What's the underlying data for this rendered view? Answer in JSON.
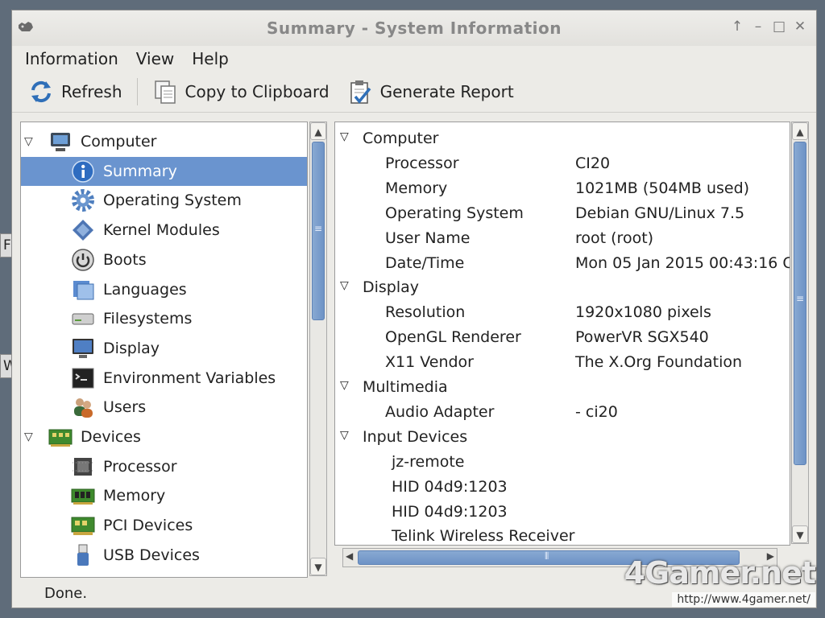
{
  "desktop": {
    "frag1": "Fi",
    "frag2": "Wa"
  },
  "window": {
    "title": "Summary - System Information",
    "controls": {
      "up": "↑",
      "minimize": "–",
      "maximize": "□",
      "close": "✕"
    }
  },
  "menu": [
    "Information",
    "View",
    "Help"
  ],
  "toolbar": {
    "refresh": "Refresh",
    "copy": "Copy to Clipboard",
    "report": "Generate Report"
  },
  "tree": [
    {
      "label": "Computer",
      "icon": "computer-icon",
      "level": 0,
      "expanded": true
    },
    {
      "label": "Summary",
      "icon": "info-icon",
      "level": 1,
      "selected": true
    },
    {
      "label": "Operating System",
      "icon": "gear-icon",
      "level": 1
    },
    {
      "label": "Kernel Modules",
      "icon": "module-icon",
      "level": 1
    },
    {
      "label": "Boots",
      "icon": "power-icon",
      "level": 1
    },
    {
      "label": "Languages",
      "icon": "language-icon",
      "level": 1
    },
    {
      "label": "Filesystems",
      "icon": "drive-icon",
      "level": 1
    },
    {
      "label": "Display",
      "icon": "monitor-icon",
      "level": 1
    },
    {
      "label": "Environment Variables",
      "icon": "terminal-icon",
      "level": 1
    },
    {
      "label": "Users",
      "icon": "users-icon",
      "level": 1
    },
    {
      "label": "Devices",
      "icon": "board-icon",
      "level": 0,
      "expanded": true
    },
    {
      "label": "Processor",
      "icon": "chip-icon",
      "level": 1
    },
    {
      "label": "Memory",
      "icon": "memory-icon",
      "level": 1
    },
    {
      "label": "PCI Devices",
      "icon": "pci-icon",
      "level": 1
    },
    {
      "label": "USB Devices",
      "icon": "usb-icon",
      "level": 1
    }
  ],
  "details": [
    {
      "section": "Computer"
    },
    {
      "key": "Processor",
      "value": "CI20"
    },
    {
      "key": "Memory",
      "value": "1021MB (504MB used)"
    },
    {
      "key": "Operating System",
      "value": "Debian GNU/Linux 7.5"
    },
    {
      "key": "User Name",
      "value": "root (root)"
    },
    {
      "key": "Date/Time",
      "value": "Mon 05 Jan 2015 00:43:16 C"
    },
    {
      "section": "Display"
    },
    {
      "key": "Resolution",
      "value": "1920x1080 pixels"
    },
    {
      "key": "OpenGL Renderer",
      "value": "PowerVR SGX540"
    },
    {
      "key": "X11 Vendor",
      "value": "The X.Org Foundation"
    },
    {
      "section": "Multimedia"
    },
    {
      "key": "Audio Adapter",
      "value": "- ci20"
    },
    {
      "section": "Input Devices"
    },
    {
      "item": "jz-remote"
    },
    {
      "item": "HID 04d9:1203"
    },
    {
      "item": "HID 04d9:1203"
    },
    {
      "item": "Telink Wireless Receiver"
    }
  ],
  "status": "Done.",
  "watermark": {
    "logo": "4Gamer.net",
    "url": "http://www.4gamer.net/"
  },
  "colors": {
    "selection": "#6a94cf",
    "scroll_thumb": "#7a9dcc"
  }
}
